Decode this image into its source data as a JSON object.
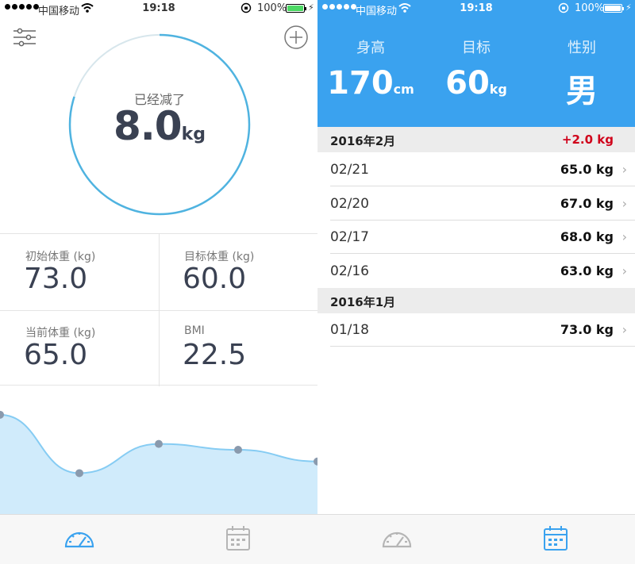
{
  "status_bar": {
    "carrier": "中国移动",
    "time": "19:18",
    "battery": "100%"
  },
  "dashboard": {
    "ring_label": "已经减了",
    "ring_value": "8.0",
    "ring_unit": "kg",
    "ring_progress": 0.8,
    "stats": [
      {
        "label": "初始体重 (kg)",
        "value": "73.0"
      },
      {
        "label": "目标体重 (kg)",
        "value": "60.0"
      },
      {
        "label": "当前体重 (kg)",
        "value": "65.0"
      },
      {
        "label": "BMI",
        "value": "22.5"
      }
    ],
    "colors": {
      "accent": "#4fb3e0",
      "fill": "#d0ebfb",
      "line": "#86ccf3",
      "dot": "#8a9aad"
    }
  },
  "chart_data": {
    "type": "area",
    "x": [
      "01/18",
      "02/16",
      "02/17",
      "02/20",
      "02/21"
    ],
    "values": [
      73.0,
      63.0,
      68.0,
      67.0,
      65.0
    ]
  },
  "profile": {
    "height_label": "身高",
    "height_value": "170",
    "height_unit": "cm",
    "target_label": "目标",
    "target_value": "60",
    "target_unit": "kg",
    "gender_label": "性别",
    "gender_value": "男",
    "header_color": "#3aa2ef"
  },
  "history": {
    "sections": [
      {
        "title": "2016年2月",
        "delta": "+2.0 kg",
        "entries": [
          {
            "date": "02/21",
            "weight": "65.0 kg"
          },
          {
            "date": "02/20",
            "weight": "67.0 kg"
          },
          {
            "date": "02/17",
            "weight": "68.0 kg"
          },
          {
            "date": "02/16",
            "weight": "63.0 kg"
          }
        ]
      },
      {
        "title": "2016年1月",
        "delta": "",
        "entries": [
          {
            "date": "01/18",
            "weight": "73.0 kg"
          }
        ]
      }
    ]
  },
  "tabs": [
    {
      "icon": "speedometer-icon"
    },
    {
      "icon": "calendar-icon"
    }
  ]
}
